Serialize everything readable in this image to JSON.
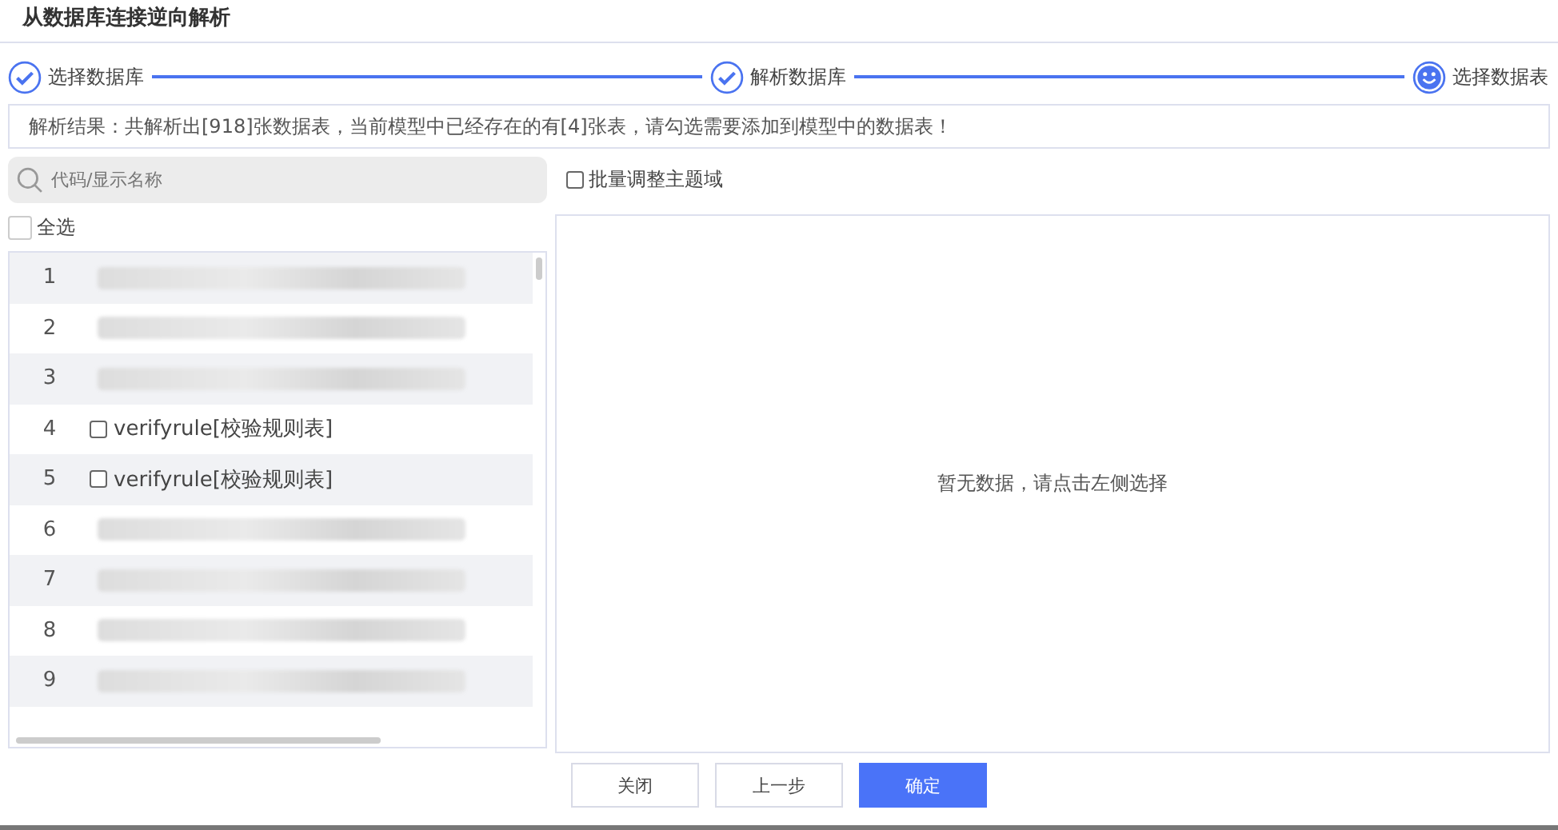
{
  "window": {
    "title": "从数据库连接逆向解析"
  },
  "steps": [
    {
      "label": "选择数据库",
      "kind": "done"
    },
    {
      "label": "解析数据库",
      "kind": "done"
    },
    {
      "label": "选择数据表",
      "kind": "current"
    }
  ],
  "result_message": "解析结果：共解析出[918]张数据表，当前模型中已经存在的有[4]张表，请勾选需要添加到模型中的数据表！",
  "search": {
    "placeholder": "代码/显示名称"
  },
  "batch_option": {
    "label": "批量调整主题域",
    "checked": false
  },
  "select_all": {
    "label": "全选",
    "checked": false
  },
  "tables": [
    {
      "index": "1",
      "kind": "redacted"
    },
    {
      "index": "2",
      "kind": "redacted"
    },
    {
      "index": "3",
      "kind": "redacted"
    },
    {
      "index": "4",
      "kind": "table",
      "name": "verifyrule[校验规则表]",
      "checked": false
    },
    {
      "index": "5",
      "kind": "table",
      "name": "verifyrule[校验规则表]",
      "checked": false
    },
    {
      "index": "6",
      "kind": "redacted"
    },
    {
      "index": "7",
      "kind": "redacted"
    },
    {
      "index": "8",
      "kind": "redacted"
    },
    {
      "index": "9",
      "kind": "redacted"
    }
  ],
  "empty_message": "暂无数据，请点击左侧选择",
  "buttons": [
    {
      "label": "关闭",
      "kind": "default"
    },
    {
      "label": "上一步",
      "kind": "default"
    },
    {
      "label": "确定",
      "kind": "primary"
    }
  ]
}
